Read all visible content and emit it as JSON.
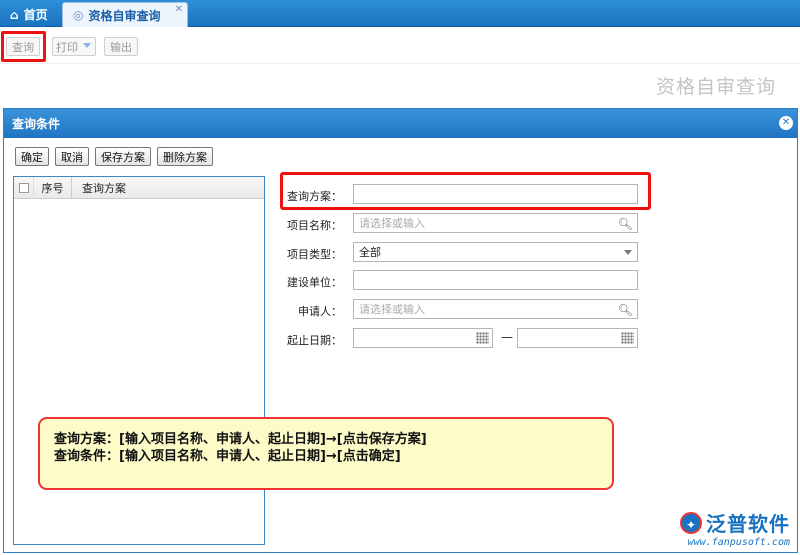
{
  "tabs": [
    {
      "label": "首页",
      "icon": "home-icon"
    },
    {
      "label": "资格自审查询",
      "icon": "page-icon",
      "close": "✕"
    }
  ],
  "toolbar": {
    "query_label": "查询",
    "print_label": "打印",
    "export_label": "输出"
  },
  "page_title": "资格自审查询",
  "dialog": {
    "title": "查询条件",
    "buttons": {
      "confirm": "确定",
      "cancel": "取消",
      "save_plan": "保存方案",
      "delete_plan": "删除方案"
    },
    "grid": {
      "columns": [
        "序号",
        "查询方案"
      ],
      "rows": []
    },
    "form": {
      "plan_label": "查询方案：",
      "plan_value": "",
      "project_name_label": "项目名称：",
      "project_name_placeholder": "请选择或输入",
      "project_type_label": "项目类型：",
      "project_type_value": "全部",
      "build_unit_label": "建设单位：",
      "build_unit_value": "",
      "applicant_label": "申请人：",
      "applicant_placeholder": "请选择或输入",
      "date_label": "起止日期：",
      "date_separator": "—",
      "date_start": "",
      "date_end": ""
    }
  },
  "callout": {
    "line1": "查询方案：[输入项目名称、申请人、起止日期]→[点击保存方案]",
    "line2": "查询条件：[输入项目名称、申请人、起止日期]→[点击确定]"
  },
  "logo": {
    "name": "泛普软件",
    "url": "www.fanpusoft.com"
  },
  "colors": {
    "accent_blue": "#1a73c0",
    "highlight_red": "#e11111",
    "callout_bg": "#fdfbc8"
  }
}
